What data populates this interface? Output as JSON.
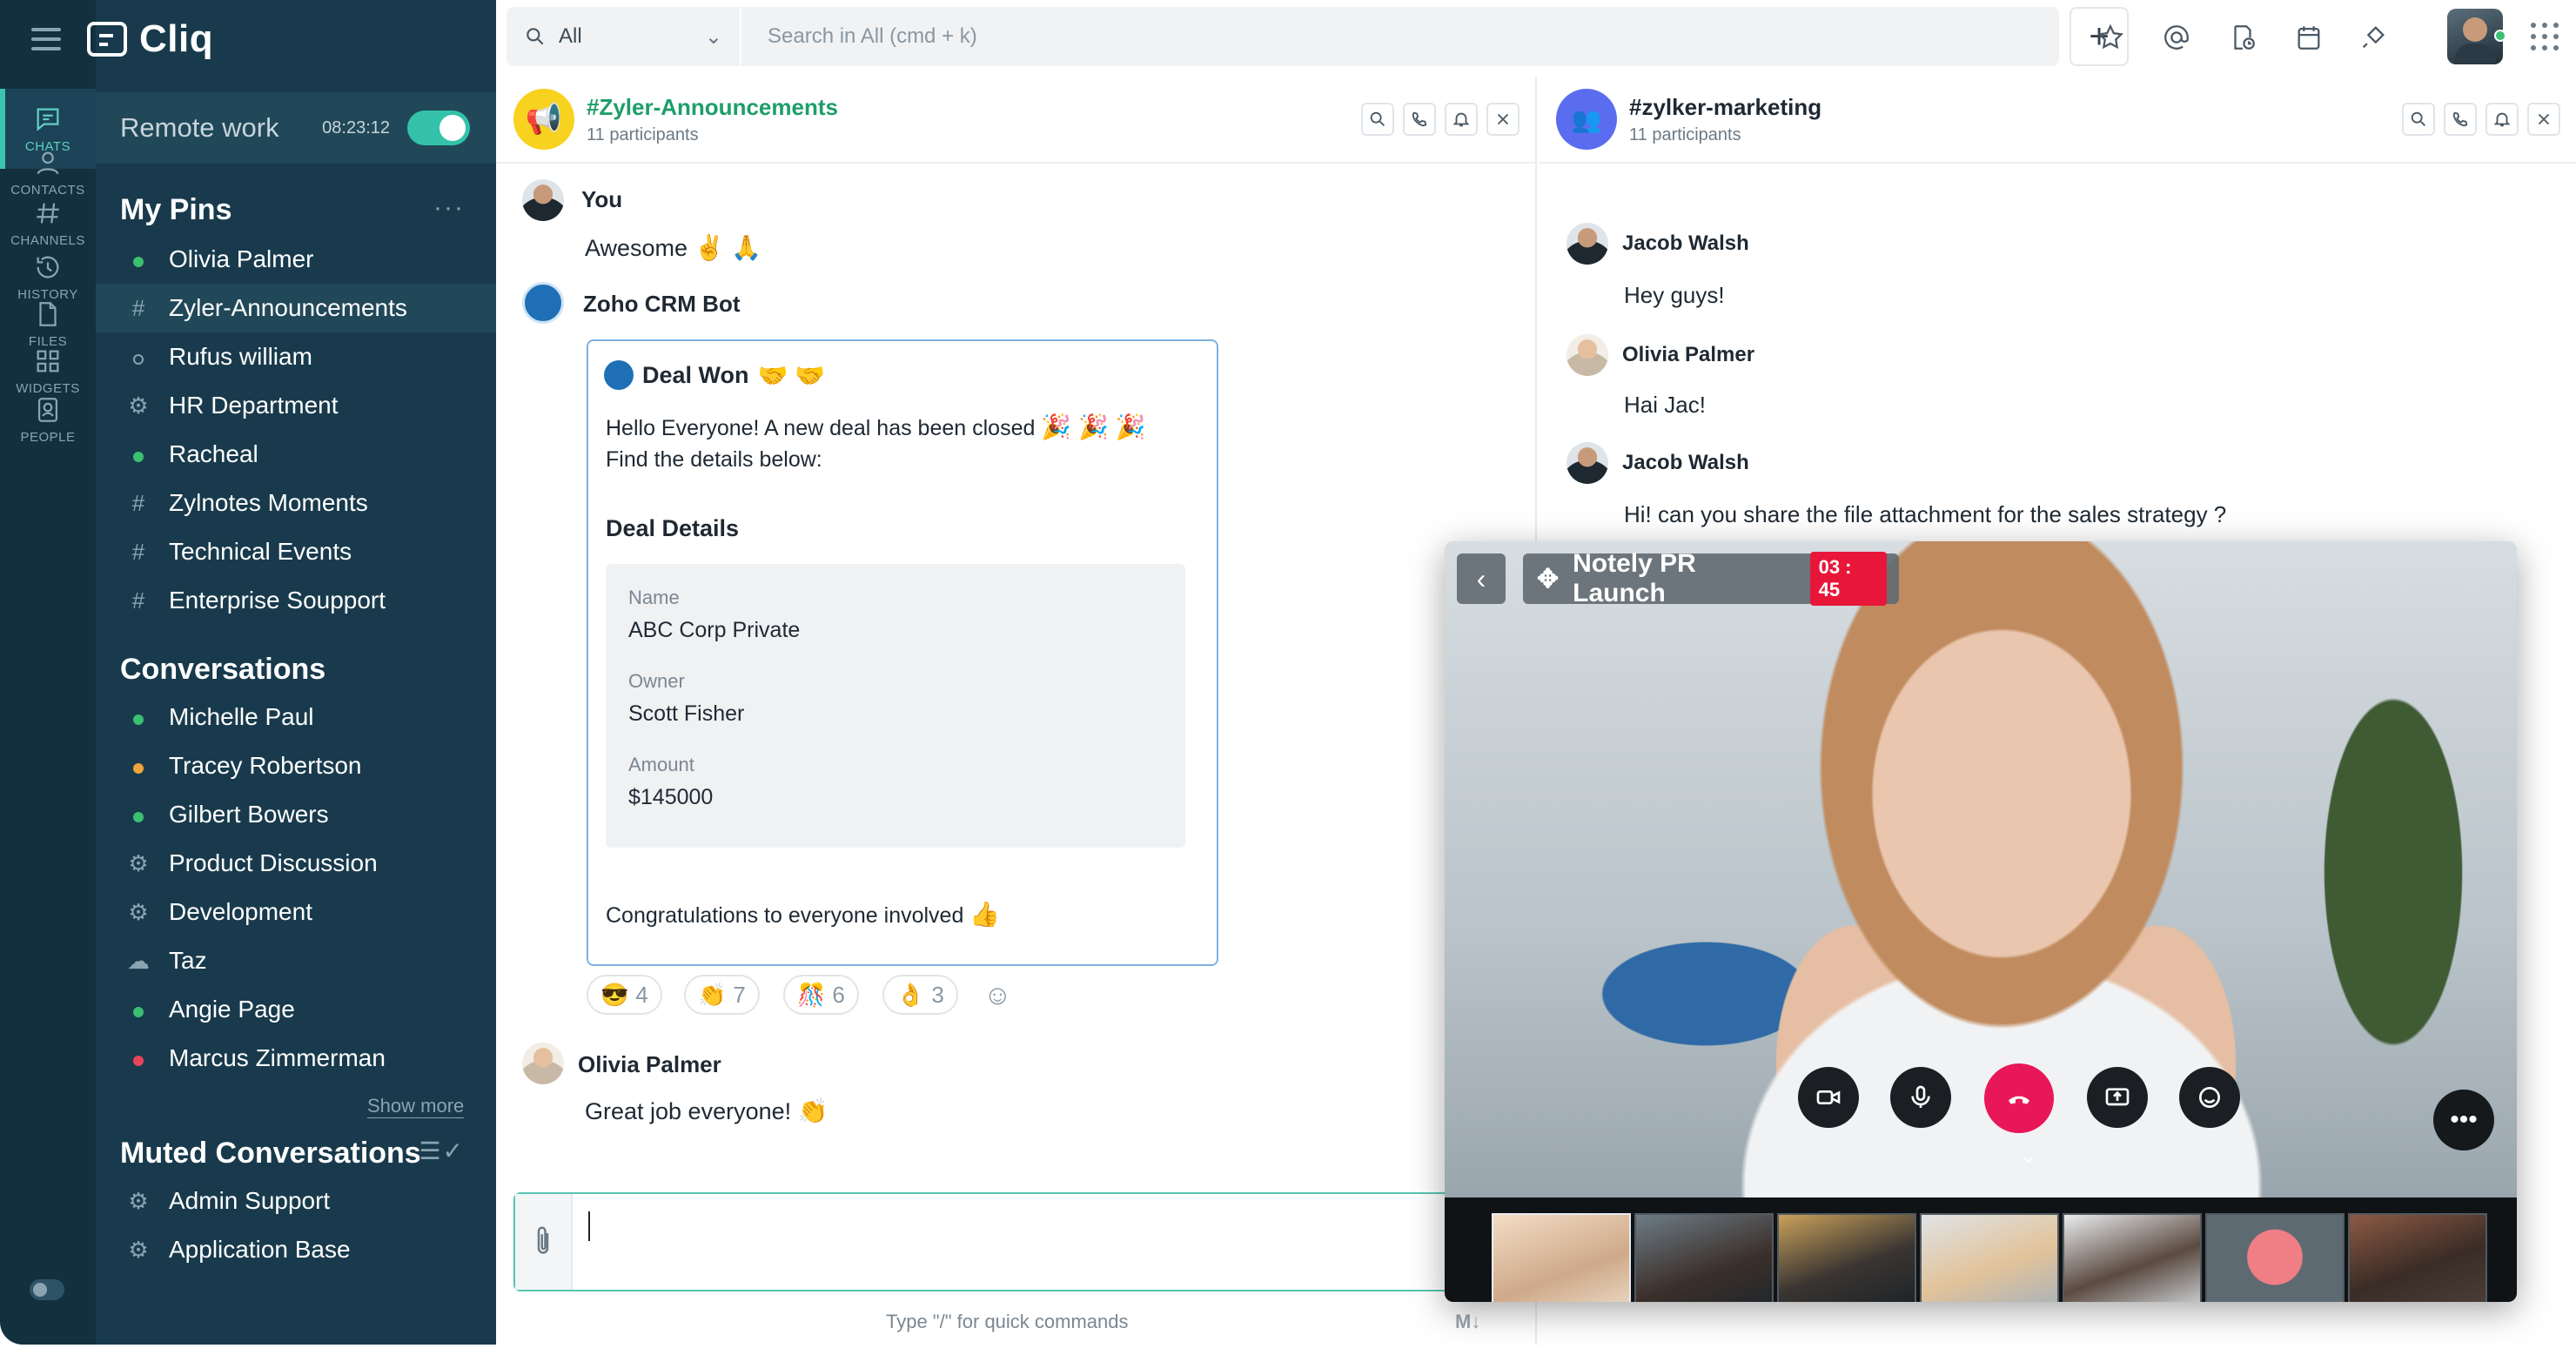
{
  "app": {
    "name": "Cliq"
  },
  "rail": {
    "items": [
      {
        "label": "CHATS",
        "icon": "chat-icon",
        "active": true
      },
      {
        "label": "CONTACTS",
        "icon": "contact-icon"
      },
      {
        "label": "CHANNELS",
        "icon": "hash-icon"
      },
      {
        "label": "HISTORY",
        "icon": "history-icon"
      },
      {
        "label": "FILES",
        "icon": "file-icon"
      },
      {
        "label": "WIDGETS",
        "icon": "widgets-icon"
      },
      {
        "label": "PEOPLE",
        "icon": "people-icon"
      }
    ]
  },
  "status": {
    "label": "Remote work",
    "timer": "08:23:12",
    "enabled": true
  },
  "pins": {
    "title": "My Pins",
    "more": "···",
    "items": [
      {
        "label": "Olivia Palmer",
        "marker": "dot-online"
      },
      {
        "label": "Zyler-Announcements",
        "marker": "hash",
        "selected": true
      },
      {
        "label": "Rufus william",
        "marker": "dot-offline"
      },
      {
        "label": "HR Department",
        "marker": "group-icon"
      },
      {
        "label": "Racheal",
        "marker": "dot-online"
      },
      {
        "label": "Zylnotes Moments",
        "marker": "hash"
      },
      {
        "label": "Technical Events",
        "marker": "hash"
      },
      {
        "label": "Enterprise Soupport",
        "marker": "hash"
      }
    ]
  },
  "conversations": {
    "title": "Conversations",
    "items": [
      {
        "label": "Michelle Paul",
        "marker": "dot-online"
      },
      {
        "label": "Tracey Robertson",
        "marker": "dot-away"
      },
      {
        "label": "Gilbert Bowers",
        "marker": "dot-online"
      },
      {
        "label": "Product Discussion",
        "marker": "group-icon"
      },
      {
        "label": "Development",
        "marker": "group-icon"
      },
      {
        "label": "Taz",
        "marker": "bot-icon"
      },
      {
        "label": "Angie Page",
        "marker": "dot-online"
      },
      {
        "label": "Marcus Zimmerman",
        "marker": "dot-busy"
      }
    ],
    "show_more": "Show more"
  },
  "muted": {
    "title": "Muted Conversations",
    "items": [
      {
        "label": "Admin Support",
        "marker": "group-icon"
      },
      {
        "label": "Application Base",
        "marker": "group-icon"
      }
    ]
  },
  "topbar": {
    "scope": "All",
    "search_placeholder": "Search in All (cmd + k)",
    "add_label": "+",
    "icons": [
      "star-icon",
      "mention-icon",
      "reminder-icon",
      "calendar-icon",
      "plugin-icon",
      "apps-grid-icon"
    ]
  },
  "left_pane": {
    "channel": "#Zyler-Announcements",
    "participants": "11 participants",
    "messages": {
      "you_author": "You",
      "you_text": "Awesome",
      "you_emoji": "✌️ 🙏",
      "bot_author": "Zoho CRM Bot",
      "card": {
        "title": "Deal Won",
        "title_emoji": "🤝 🤝",
        "line1": "Hello Everyone! A new deal has been closed",
        "line1_emoji": "🎉 🎉 🎉",
        "line2": "Find the details below:",
        "heading": "Deal Details",
        "fields": [
          {
            "key": "Name",
            "value": "ABC Corp Private"
          },
          {
            "key": "Owner",
            "value": "Scott Fisher"
          },
          {
            "key": "Amount",
            "value": "$145000"
          }
        ],
        "footer": "Congratulations to everyone involved",
        "footer_emoji": "👍"
      },
      "reactions": [
        {
          "emoji": "😎",
          "count": "4"
        },
        {
          "emoji": "👏",
          "count": "7"
        },
        {
          "emoji": "🎊",
          "count": "6"
        },
        {
          "emoji": "👌",
          "count": "3"
        }
      ],
      "olivia_author": "Olivia Palmer",
      "olivia_text": "Great job everyone!",
      "olivia_emoji": "👏"
    },
    "composer_hint": "Type \"/\" for quick commands",
    "markdown_label": "M↓"
  },
  "right_pane": {
    "channel": "#zylker-marketing",
    "participants": "11 participants",
    "messages": [
      {
        "author": "Jacob Walsh",
        "text": "Hey guys!"
      },
      {
        "author": "Olivia Palmer",
        "text": "Hai Jac!"
      },
      {
        "author": "Jacob Walsh",
        "text": "Hi! can you share the file attachment for the sales strategy ?"
      }
    ]
  },
  "call": {
    "title": "Notely PR Launch",
    "timer": "03 : 45",
    "controls": [
      "video-icon",
      "mic-icon",
      "end-call-icon",
      "screen-share-icon",
      "emoji-icon",
      "more-icon"
    ],
    "participants_count": 7
  },
  "colors": {
    "rail": "#13303f",
    "sidebar": "#183a4c",
    "accent": "#33c2a9",
    "end_call": "#e8175a",
    "timer_badge": "#e8173a"
  }
}
